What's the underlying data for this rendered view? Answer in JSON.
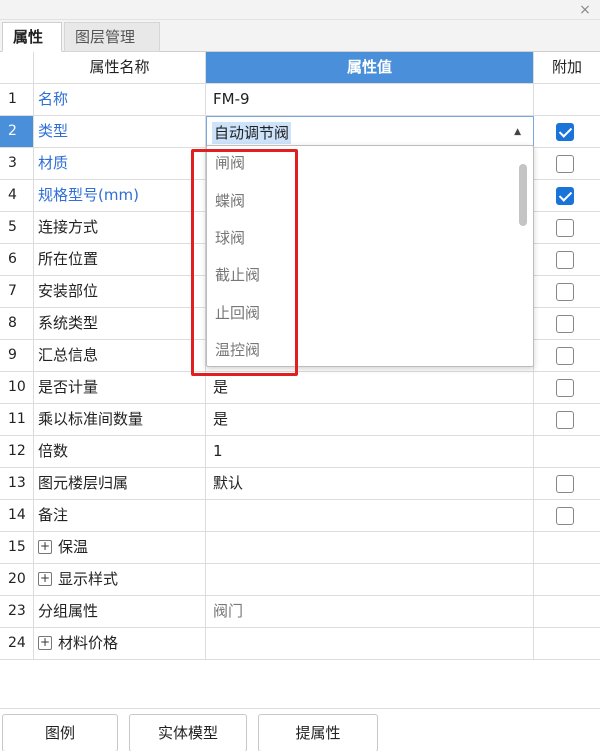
{
  "window": {
    "close_glyph": "×"
  },
  "tabs": [
    {
      "label": "属性",
      "active": true
    },
    {
      "label": "图层管理",
      "active": false
    }
  ],
  "table": {
    "headers": {
      "num": "",
      "name": "属性名称",
      "value": "属性值",
      "addon": "附加"
    },
    "rows": [
      {
        "num": "1",
        "name": "名称",
        "value": "FM-9"
      },
      {
        "num": "2",
        "name": "类型",
        "value": "自动调节阀"
      },
      {
        "num": "3",
        "name": "材质",
        "value": ""
      },
      {
        "num": "4",
        "name": "规格型号(mm)",
        "value": ""
      },
      {
        "num": "5",
        "name": "连接方式",
        "value": ""
      },
      {
        "num": "6",
        "name": "所在位置",
        "value": ""
      },
      {
        "num": "7",
        "name": "安装部位",
        "value": ""
      },
      {
        "num": "8",
        "name": "系统类型",
        "value": ""
      },
      {
        "num": "9",
        "name": "汇总信息",
        "value": ""
      },
      {
        "num": "10",
        "name": "是否计量",
        "value": "是"
      },
      {
        "num": "11",
        "name": "乘以标准间数量",
        "value": "是"
      },
      {
        "num": "12",
        "name": "倍数",
        "value": "1"
      },
      {
        "num": "13",
        "name": "图元楼层归属",
        "value": "默认"
      },
      {
        "num": "14",
        "name": "备注",
        "value": ""
      },
      {
        "num": "15",
        "name": "保温",
        "value": ""
      },
      {
        "num": "20",
        "name": "显示样式",
        "value": ""
      },
      {
        "num": "23",
        "name": "分组属性",
        "value": "阀门"
      },
      {
        "num": "24",
        "name": "材料价格",
        "value": ""
      }
    ]
  },
  "dropdown": {
    "options": [
      "闸阀",
      "蝶阀",
      "球阀",
      "截止阀",
      "止回阀",
      "温控阀"
    ]
  },
  "buttons": {
    "legend": "图例",
    "solid_model": "实体模型",
    "extract_props": "提属性"
  },
  "colors": {
    "header_accent": "#4a8fd9",
    "link_blue": "#2f6fd6",
    "checkbox_checked": "#1a73d9",
    "highlight_box": "#e02020"
  },
  "icons": {
    "expander": "+",
    "combo_arrow": "▲"
  }
}
